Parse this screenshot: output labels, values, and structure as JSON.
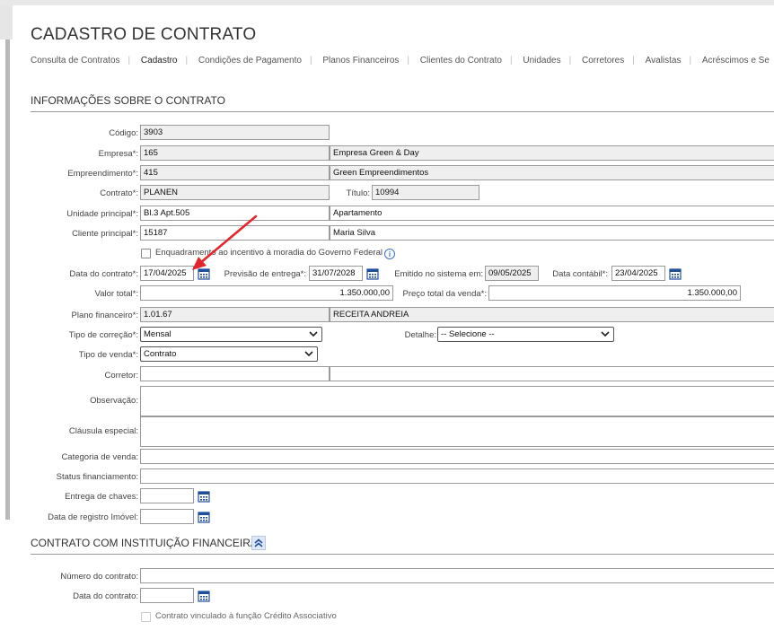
{
  "page": {
    "title": "CADASTRO DE CONTRATO"
  },
  "tabs": [
    {
      "label": "Consulta de Contratos"
    },
    {
      "label": "Cadastro"
    },
    {
      "label": "Condições de Pagamento"
    },
    {
      "label": "Planos Financeiros"
    },
    {
      "label": "Clientes do Contrato"
    },
    {
      "label": "Unidades"
    },
    {
      "label": "Corretores"
    },
    {
      "label": "Avalistas"
    },
    {
      "label": "Acréscimos e Se"
    }
  ],
  "info_section": {
    "title": "INFORMAÇÕES SOBRE O CONTRATO",
    "codigo": {
      "label": "Código:",
      "value": "3903"
    },
    "empresa": {
      "label": "Empresa*:",
      "code": "165",
      "name": "Empresa Green & Day"
    },
    "empreendimento": {
      "label": "Empreendimento*:",
      "code": "415",
      "name": "Green Empreendimentos"
    },
    "contrato": {
      "label": "Contrato*:",
      "value": "PLANEN"
    },
    "titulo": {
      "label": "Título:",
      "value": "10994"
    },
    "unidade_principal": {
      "label": "Unidade principal*:",
      "code": "Bl.3 Apt.505",
      "name": "Apartamento"
    },
    "cliente_principal": {
      "label": "Cliente principal*:",
      "code": "15187",
      "name": "Maria Silva"
    },
    "enquadramento": {
      "label": "Enquadramento ao incentivo à moradia do Governo Federal",
      "checked": false
    },
    "data_contrato": {
      "label": "Data do contrato*:",
      "value": "17/04/2025"
    },
    "previsao_entrega": {
      "label": "Previsão de entrega*:",
      "value": "31/07/2028"
    },
    "emitido_sistema": {
      "label": "Emitido no sistema em:",
      "value": "09/05/2025"
    },
    "data_contabil": {
      "label": "Data contábil*:",
      "value": "23/04/2025"
    },
    "valor_total": {
      "label": "Valor total*:",
      "value": "1.350.000,00"
    },
    "preco_total_venda": {
      "label": "Preço total da venda*:",
      "value": "1.350.000,00"
    },
    "plano_financeiro": {
      "label": "Plano financeiro*:",
      "code": "1.01.67",
      "name": "RECEITA ANDREIA"
    },
    "tipo_correcao": {
      "label": "Tipo de correção*:",
      "value": "Mensal"
    },
    "detalhe": {
      "label": "Detalhe:",
      "value": "-- Selecione --"
    },
    "tipo_venda": {
      "label": "Tipo de venda*:",
      "value": "Contrato"
    },
    "corretor": {
      "label": "Corretor:",
      "code": "",
      "name": ""
    },
    "observacao": {
      "label": "Observação:",
      "value": ""
    },
    "clausula_especial": {
      "label": "Cláusula especial:",
      "value": ""
    },
    "categoria_venda": {
      "label": "Categoria de venda:",
      "value": ""
    },
    "status_financiamento": {
      "label": "Status financiamento:",
      "value": ""
    },
    "entrega_chaves": {
      "label": "Entrega de chaves:",
      "value": ""
    },
    "data_registro_imovel": {
      "label": "Data de registro Imóvel:",
      "value": ""
    }
  },
  "finance_section": {
    "title": "CONTRATO COM INSTITUIÇÃO FINANCEIRA",
    "numero_contrato": {
      "label": "Número do contrato:",
      "value": ""
    },
    "data_contrato": {
      "label": "Data do contrato:",
      "value": ""
    },
    "credito_associativo": {
      "label": "Contrato vinculado à função Crédito Associativo",
      "checked": false
    }
  },
  "colors": {
    "accent": "#3a6fc4",
    "readonly_bg": "#efefef",
    "annotation_arrow": "#e3262d"
  },
  "icons": {
    "calendar": "calendar-icon",
    "info": "info-icon",
    "collapse": "chevron-up-icon",
    "dropdown": "chevron-down-icon"
  }
}
